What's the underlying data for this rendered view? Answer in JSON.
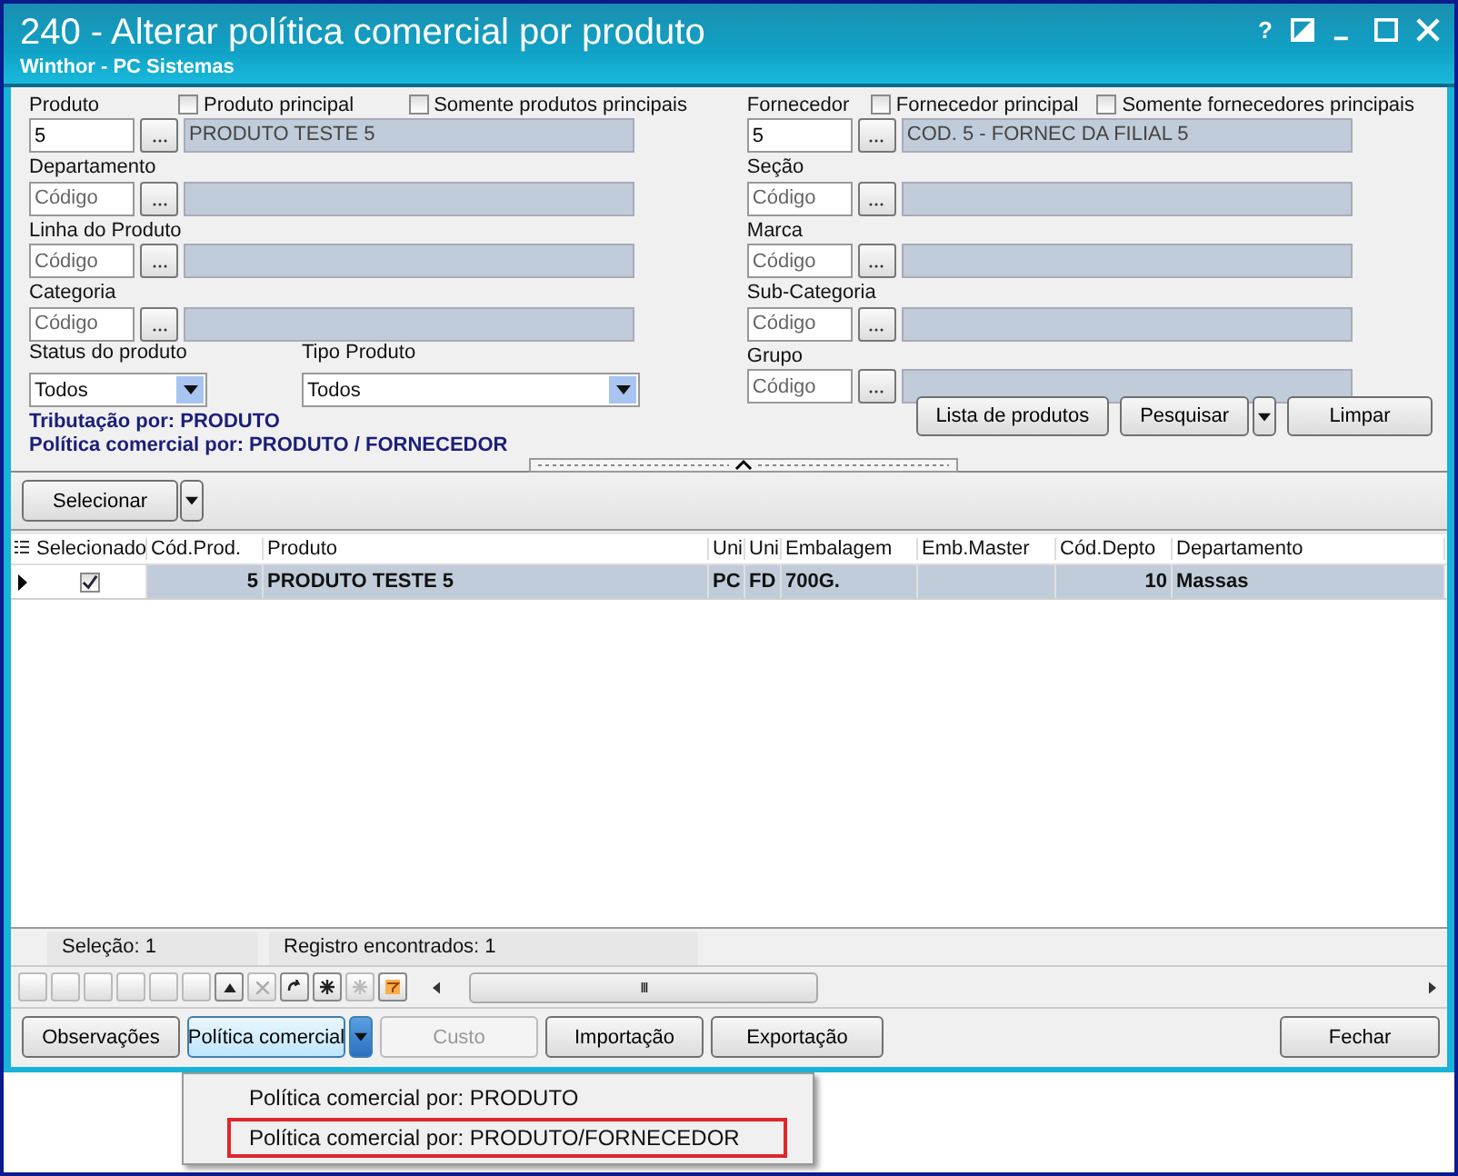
{
  "window": {
    "title": "240 - Alterar política comercial por produto",
    "subtitle": "Winthor - PC Sistemas",
    "help": "?"
  },
  "filters": {
    "left": [
      {
        "kind": "lookup",
        "label": "Produto",
        "value": "5",
        "description": "PRODUTO TESTE 5",
        "options": [
          {
            "label": "Produto principal",
            "checked": false
          },
          {
            "label": "Somente produtos principais",
            "checked": false
          }
        ]
      },
      {
        "kind": "lookup",
        "label": "Departamento",
        "placeholder": "Código"
      },
      {
        "kind": "lookup",
        "label": "Linha do Produto",
        "placeholder": "Código"
      },
      {
        "kind": "lookup",
        "label": "Categoria",
        "placeholder": "Código"
      },
      {
        "kind": "selects",
        "items": [
          {
            "label": "Status do produto",
            "value": "Todos"
          },
          {
            "label": "Tipo Produto",
            "value": "Todos"
          }
        ]
      }
    ],
    "right": [
      {
        "kind": "lookup",
        "label": "Fornecedor",
        "value": "5",
        "description": "COD. 5 - FORNEC DA FILIAL 5",
        "options": [
          {
            "label": "Fornecedor principal",
            "checked": false
          },
          {
            "label": "Somente fornecedores principais",
            "checked": false
          }
        ]
      },
      {
        "kind": "lookup",
        "label": "Seção",
        "placeholder": "Código"
      },
      {
        "kind": "lookup",
        "label": "Marca",
        "placeholder": "Código"
      },
      {
        "kind": "lookup",
        "label": "Sub-Categoria",
        "placeholder": "Código"
      },
      {
        "kind": "lookup",
        "label": "Grupo",
        "placeholder": "Código"
      }
    ]
  },
  "info_lines": [
    "Tributação por: PRODUTO",
    "Política comercial por: PRODUTO / FORNECEDOR"
  ],
  "filter_buttons": [
    {
      "label": "Lista de produtos",
      "kind": "plain"
    },
    {
      "label": "Pesquisar",
      "kind": "split"
    },
    {
      "label": "Limpar",
      "kind": "plain"
    }
  ],
  "toolbar": {
    "button": "Selecionar"
  },
  "table": {
    "check_column": "Selecionado",
    "columns": [
      "Cód.Prod.",
      "Produto",
      "Uni",
      "Uni",
      "Embalagem",
      "Emb.Master",
      "Cód.Depto",
      "Departamento"
    ],
    "rows": [
      {
        "selected": true,
        "checked": true,
        "cells": [
          "5",
          "PRODUTO TESTE 5",
          "PC",
          "FD",
          "700G.",
          "",
          "10",
          "Massas"
        ]
      }
    ]
  },
  "status_bar": [
    "Seleção: 1",
    "Registro encontrados: 1"
  ],
  "scroll_grip": "III",
  "buttons": [
    {
      "label": "Observações",
      "kind": "plain",
      "disabled": false
    },
    {
      "label": "Política comercial",
      "kind": "split",
      "disabled": false
    },
    {
      "label": "Custo",
      "kind": "plain",
      "disabled": true
    },
    {
      "label": "Importação",
      "kind": "plain",
      "disabled": false
    },
    {
      "label": "Exportação",
      "kind": "plain",
      "disabled": false
    },
    {
      "label": "Fechar",
      "kind": "right",
      "disabled": false
    }
  ],
  "menu": [
    {
      "label": "Política comercial por: PRODUTO",
      "selected": false
    },
    {
      "label": "Política comercial por: PRODUTO/FORNECEDOR",
      "selected": true
    }
  ]
}
